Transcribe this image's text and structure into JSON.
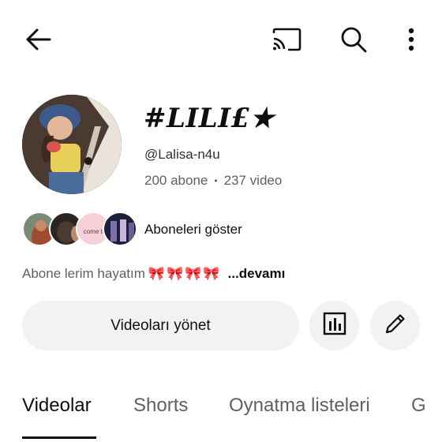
{
  "topbar": {
    "icons": [
      "back-arrow-icon",
      "cast-icon",
      "search-icon",
      "more-vert-icon"
    ]
  },
  "channel": {
    "name": "#LILI£★",
    "handle": "@Lalisa-n4u",
    "subscribers": "200 abone",
    "separator": "•",
    "videos": "237 video"
  },
  "subscribers_row": {
    "label": "Aboneleri göster",
    "avatar_text": "come to"
  },
  "description": {
    "text": "Abone lerim hayatım",
    "emoji": [
      "🎀",
      "🎀",
      "🎀",
      "🎀"
    ],
    "more": "...devamı"
  },
  "actions": {
    "manage_label": "Videoları yönet",
    "stats_icon": "analytics-icon",
    "edit_icon": "pencil-icon"
  },
  "tabs": [
    "Videolar",
    "Shorts",
    "Oynatma listeleri",
    "G"
  ],
  "colors": {
    "text": "#0f0f0f",
    "secondary": "#606060",
    "button_bg": "#f2f2f2"
  }
}
